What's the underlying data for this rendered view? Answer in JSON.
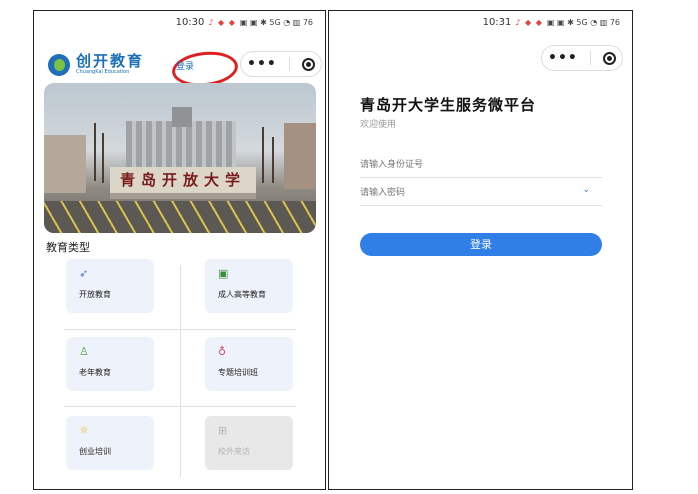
{
  "left": {
    "status_time": "10:30",
    "status_icons": "♪ ◆ ◆",
    "status_sys": "▣ ▣ ✱ 5G ◔ ▥ 76",
    "logo_cn": "创开教育",
    "logo_en": "ChuangKai Education",
    "login_link": "登录",
    "banner_sign": "青岛开放大学",
    "section_title": "教育类型",
    "tiles": [
      {
        "icon": "➶",
        "label": "开放教育",
        "color": "#4a7ad6"
      },
      {
        "icon": "▣",
        "label": "成人高等教育",
        "color": "#3d8a3a"
      },
      {
        "icon": "♙",
        "label": "老年教育",
        "color": "#47a83c"
      },
      {
        "icon": "♁",
        "label": "专题培训班",
        "color": "#d4445f"
      },
      {
        "icon": "☼",
        "label": "创业培训",
        "color": "#e9b33a"
      },
      {
        "icon": "⊞",
        "label": "校外来访",
        "color": "#b5b5b5"
      }
    ]
  },
  "right": {
    "status_time": "10:31",
    "status_icons": "♪ ◆ ◆",
    "status_sys": "▣ ▣ ✱ 5G ◔ ▥ 76",
    "title": "青岛开大学生服务微平台",
    "subtitle": "欢迎使用",
    "id_placeholder": "请输入身份证号",
    "password_placeholder": "请输入密码",
    "chevron": "⌄",
    "login_button": "登录"
  }
}
